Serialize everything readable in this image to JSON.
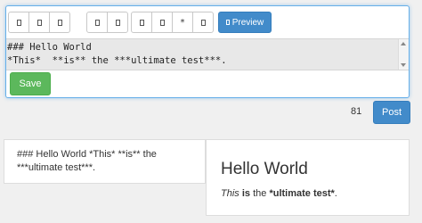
{
  "toolbar": {
    "group1": [
      {
        "icon": "bold-icon"
      },
      {
        "icon": "italic-icon"
      },
      {
        "icon": "heading-icon"
      }
    ],
    "group2": [
      {
        "icon": "link-icon"
      },
      {
        "icon": "image-icon"
      }
    ],
    "group3": [
      {
        "icon": "list-icon"
      },
      {
        "icon": "ordered-list-icon"
      },
      {
        "label": "*"
      },
      {
        "icon": "code-icon"
      }
    ],
    "preview_label": "Preview"
  },
  "editor": {
    "line1": "### Hello World",
    "line2": "*This*  **is** the ***ultimate test***."
  },
  "actions": {
    "save_label": "Save",
    "char_count": "81",
    "post_label": "Post"
  },
  "raw_output": {
    "text": "### Hello World *This* **is** the ***ultimate test***."
  },
  "rendered": {
    "heading": "Hello World",
    "em": "This",
    "strong": "is",
    "middle": " the ",
    "strong2": "*ultimate test*",
    "tail": "."
  },
  "colors": {
    "accent": "#428bca",
    "save": "#5cb85c",
    "editor_focus": "#66afe9"
  }
}
